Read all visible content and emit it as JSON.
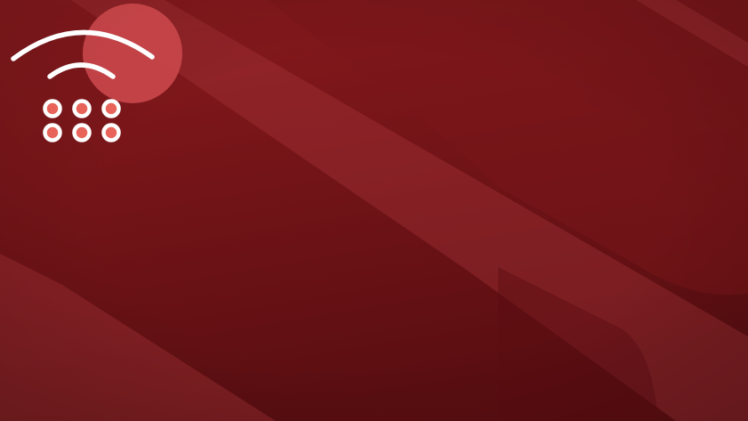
{
  "colors": {
    "background_top": "#8a1a1e",
    "background_bottom": "#5c0f12",
    "stripe": "#b43a3f",
    "accent_circle": "#c8474a",
    "icon_stroke": "#ffffff",
    "dot_fill": "#e8645a"
  },
  "logo": {
    "icon_name": "wifi-keypad-icon",
    "arcs": 2,
    "dot_rows": 2,
    "dot_columns": 3
  }
}
